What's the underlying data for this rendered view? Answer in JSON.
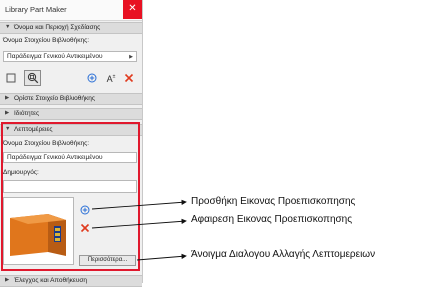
{
  "window": {
    "title": "Library Part Maker",
    "close_icon": "close-icon"
  },
  "sections": {
    "name_category": "Όνομα και Περιοχή Σχεδίασης",
    "define": "Ορίστε Στοιχείο Βιβλιοθήκης",
    "properties": "Ιδιότητες",
    "details": "Λεπτομέρειες",
    "check_save": "Έλεγχος και Αποθήκευση"
  },
  "name_section": {
    "field_label": "Όνομα Στοιχείου Βιβλιοθήκης:",
    "name_value": "Παράδειγμα Γενικού Αντικειμένου"
  },
  "toolbar": {
    "icons": [
      "rectangle-icon",
      "zoom-icon",
      "add-icon",
      "text-size-icon",
      "delete-icon"
    ],
    "text_size_glyph": "A"
  },
  "details_section": {
    "name_label": "Όνομα Στοιχείου Βιβλιοθήκης:",
    "name_value": "Παράδειγμα Γενικού Αντικειμένου",
    "author_label": "Δημιουργός:",
    "author_value": "",
    "more_button": "Περισσότερα..."
  },
  "callouts": {
    "add_preview": "Προσθήκη Εικονας Προεπισκοπησης",
    "remove_preview": "Αφαιρεση Εικονας Προεπισκοπησης",
    "open_dialog": "Άνοιγμα Διαλογου Αλλαγής Λεπτομερειων"
  },
  "colors": {
    "highlight": "#e0182d",
    "accent_blue": "#2a6fd6",
    "delete_red": "#e03a1e",
    "object_orange": "#d9731a"
  }
}
